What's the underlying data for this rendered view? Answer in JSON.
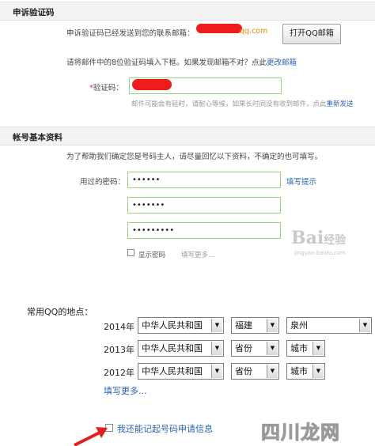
{
  "appeal": {
    "section_title": "申诉验证码",
    "sent_notice": "申诉验证码已经发送到您的联系邮箱：",
    "email_suffix": "qq.com",
    "open_mail_button": "打开QQ邮箱",
    "instruction": "请将邮件中的8位验证码填入下框。如果发现邮箱不对？点此",
    "change_email_link": "更改邮箱",
    "code_label": "验证码：",
    "required_mark": "*",
    "code_hint": "邮件可能会有延时，请耐心等候，如果长时间没有收到邮件，点此",
    "resend_link": "重新发送"
  },
  "account": {
    "section_title": "帐号基本资料",
    "intro": "为了帮助我们确定您是号码主人，请尽量回忆以下资料，不确定的也可填写。",
    "password_label": "用过的密码：",
    "password_values": [
      "••••••",
      "•••••••",
      "•••••••••"
    ],
    "fill_hint_link": "填写提示",
    "show_password_label": "显示密码",
    "fill_more_link": "填写更多..."
  },
  "locations": {
    "label": "常用QQ的地点：",
    "rows": [
      {
        "year": "2014年",
        "country": "中华人民共和国",
        "province": "福建",
        "city": "泉州"
      },
      {
        "year": "2013年",
        "country": "中华人民共和国",
        "province": "省份",
        "city": "城市"
      },
      {
        "year": "2012年",
        "country": "中华人民共和国",
        "province": "省份",
        "city": "城市"
      }
    ],
    "fill_more_link": "填写更多..."
  },
  "remember": {
    "label": "我还能记起号码申请信息"
  },
  "watermarks": {
    "baidu": "Bai",
    "baidu_cn": "经验",
    "baidu_url": "jingyan.baidu.com",
    "site_logo": "四川龙网"
  },
  "colors": {
    "link": "#2a64b8",
    "field_border": "#9ad27f",
    "redaction": "#ee1c1c",
    "arrow": "#e02020"
  },
  "icons": {
    "checkbox": "checkbox-icon",
    "dropdown": "triangle-down-icon",
    "arrow": "red-arrow-icon"
  }
}
